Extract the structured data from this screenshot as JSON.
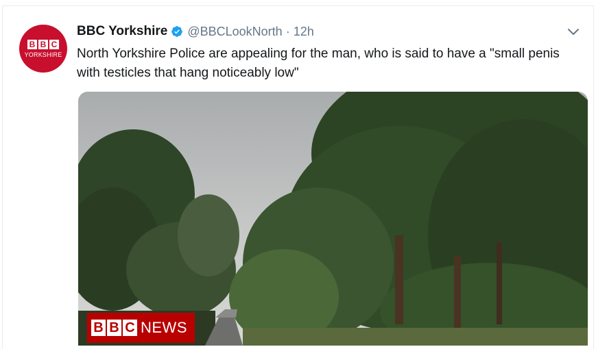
{
  "tweet": {
    "avatar": {
      "letters": [
        "B",
        "B",
        "C"
      ],
      "subtitle": "YORKSHIRE",
      "color": "#c8102e"
    },
    "author_name": "BBC Yorkshire",
    "verified_icon": "verified-badge-icon",
    "handle": "@BBCLookNorth",
    "separator": "·",
    "time": "12h",
    "menu_icon": "chevron-down-icon",
    "text": "North Yorkshire Police are appealing for the man, who is said to have a \"small penis with testicles that hang noticeably low\""
  },
  "media": {
    "badge": {
      "letters": [
        "B",
        "B",
        "C"
      ],
      "word": "NEWS",
      "color": "#b80000"
    }
  }
}
